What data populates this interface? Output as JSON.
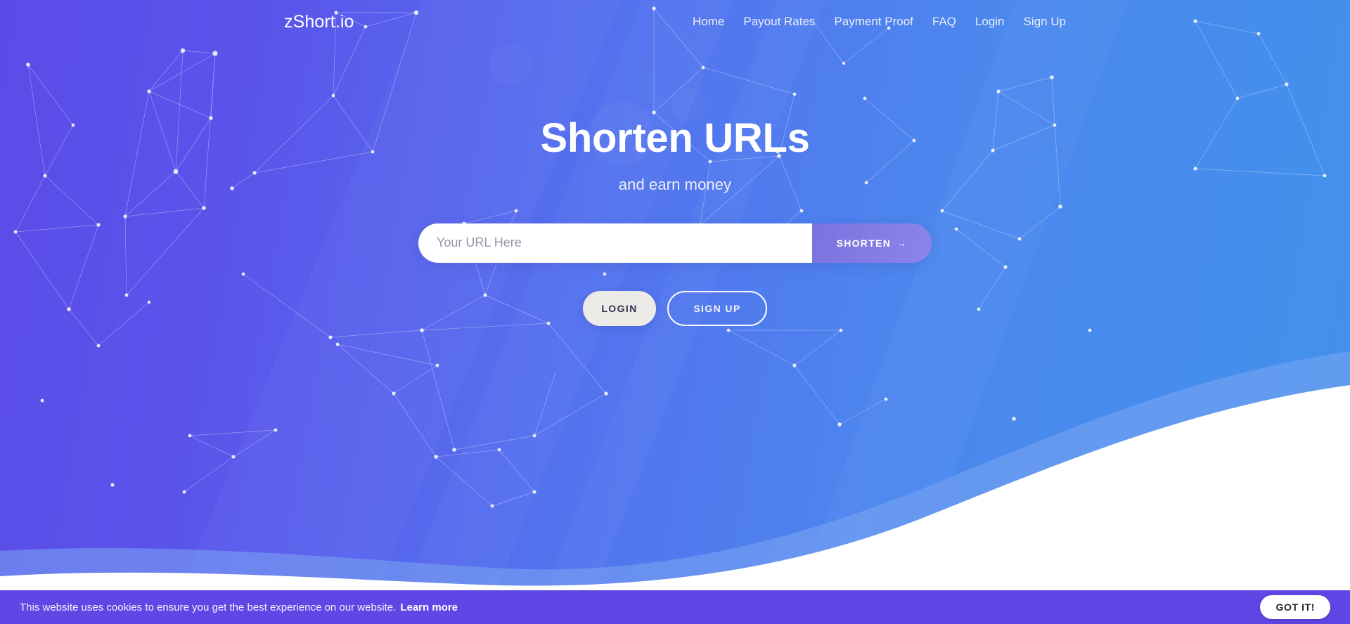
{
  "brand": {
    "name": "zShort.io"
  },
  "nav": {
    "links": [
      {
        "label": "Home"
      },
      {
        "label": "Payout Rates"
      },
      {
        "label": "Payment Proof"
      },
      {
        "label": "FAQ"
      },
      {
        "label": "Login"
      },
      {
        "label": "Sign Up"
      }
    ]
  },
  "hero": {
    "title": "Shorten URLs",
    "subtitle": "and earn money",
    "url_input": {
      "value": "",
      "placeholder": "Your URL Here"
    },
    "shorten_label": "SHORTEN",
    "shorten_arrow": "→",
    "login_label": "LOGIN",
    "signup_label": "SIGN UP"
  },
  "cookie": {
    "message": "This website uses cookies to ensure you get the best experience on our website.",
    "link_label": "Learn more",
    "accept_label": "GOT IT!"
  },
  "colors": {
    "gradient_start": "#5b4ce8",
    "gradient_end": "#4292ec",
    "shorten_button": "#8b84ea",
    "cookie_bar": "#5e47e4",
    "login_button": "#ecebe8",
    "wave_light": "#7ba6f2",
    "wave_white": "#ffffff"
  }
}
